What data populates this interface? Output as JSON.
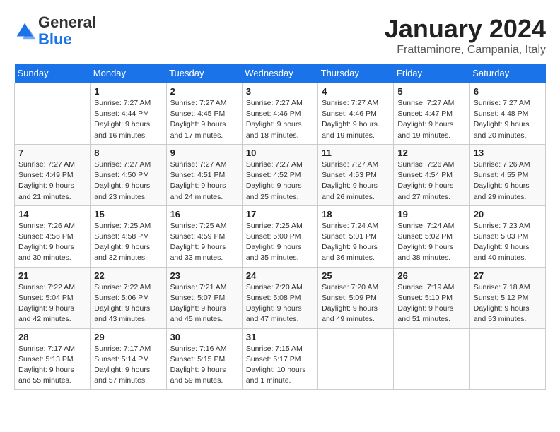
{
  "header": {
    "logo_general": "General",
    "logo_blue": "Blue",
    "month": "January 2024",
    "location": "Frattaminore, Campania, Italy"
  },
  "days_of_week": [
    "Sunday",
    "Monday",
    "Tuesday",
    "Wednesday",
    "Thursday",
    "Friday",
    "Saturday"
  ],
  "weeks": [
    [
      {
        "day": "",
        "info": ""
      },
      {
        "day": "1",
        "info": "Sunrise: 7:27 AM\nSunset: 4:44 PM\nDaylight: 9 hours\nand 16 minutes."
      },
      {
        "day": "2",
        "info": "Sunrise: 7:27 AM\nSunset: 4:45 PM\nDaylight: 9 hours\nand 17 minutes."
      },
      {
        "day": "3",
        "info": "Sunrise: 7:27 AM\nSunset: 4:46 PM\nDaylight: 9 hours\nand 18 minutes."
      },
      {
        "day": "4",
        "info": "Sunrise: 7:27 AM\nSunset: 4:46 PM\nDaylight: 9 hours\nand 19 minutes."
      },
      {
        "day": "5",
        "info": "Sunrise: 7:27 AM\nSunset: 4:47 PM\nDaylight: 9 hours\nand 19 minutes."
      },
      {
        "day": "6",
        "info": "Sunrise: 7:27 AM\nSunset: 4:48 PM\nDaylight: 9 hours\nand 20 minutes."
      }
    ],
    [
      {
        "day": "7",
        "info": "Sunrise: 7:27 AM\nSunset: 4:49 PM\nDaylight: 9 hours\nand 21 minutes."
      },
      {
        "day": "8",
        "info": "Sunrise: 7:27 AM\nSunset: 4:50 PM\nDaylight: 9 hours\nand 23 minutes."
      },
      {
        "day": "9",
        "info": "Sunrise: 7:27 AM\nSunset: 4:51 PM\nDaylight: 9 hours\nand 24 minutes."
      },
      {
        "day": "10",
        "info": "Sunrise: 7:27 AM\nSunset: 4:52 PM\nDaylight: 9 hours\nand 25 minutes."
      },
      {
        "day": "11",
        "info": "Sunrise: 7:27 AM\nSunset: 4:53 PM\nDaylight: 9 hours\nand 26 minutes."
      },
      {
        "day": "12",
        "info": "Sunrise: 7:26 AM\nSunset: 4:54 PM\nDaylight: 9 hours\nand 27 minutes."
      },
      {
        "day": "13",
        "info": "Sunrise: 7:26 AM\nSunset: 4:55 PM\nDaylight: 9 hours\nand 29 minutes."
      }
    ],
    [
      {
        "day": "14",
        "info": "Sunrise: 7:26 AM\nSunset: 4:56 PM\nDaylight: 9 hours\nand 30 minutes."
      },
      {
        "day": "15",
        "info": "Sunrise: 7:25 AM\nSunset: 4:58 PM\nDaylight: 9 hours\nand 32 minutes."
      },
      {
        "day": "16",
        "info": "Sunrise: 7:25 AM\nSunset: 4:59 PM\nDaylight: 9 hours\nand 33 minutes."
      },
      {
        "day": "17",
        "info": "Sunrise: 7:25 AM\nSunset: 5:00 PM\nDaylight: 9 hours\nand 35 minutes."
      },
      {
        "day": "18",
        "info": "Sunrise: 7:24 AM\nSunset: 5:01 PM\nDaylight: 9 hours\nand 36 minutes."
      },
      {
        "day": "19",
        "info": "Sunrise: 7:24 AM\nSunset: 5:02 PM\nDaylight: 9 hours\nand 38 minutes."
      },
      {
        "day": "20",
        "info": "Sunrise: 7:23 AM\nSunset: 5:03 PM\nDaylight: 9 hours\nand 40 minutes."
      }
    ],
    [
      {
        "day": "21",
        "info": "Sunrise: 7:22 AM\nSunset: 5:04 PM\nDaylight: 9 hours\nand 42 minutes."
      },
      {
        "day": "22",
        "info": "Sunrise: 7:22 AM\nSunset: 5:06 PM\nDaylight: 9 hours\nand 43 minutes."
      },
      {
        "day": "23",
        "info": "Sunrise: 7:21 AM\nSunset: 5:07 PM\nDaylight: 9 hours\nand 45 minutes."
      },
      {
        "day": "24",
        "info": "Sunrise: 7:20 AM\nSunset: 5:08 PM\nDaylight: 9 hours\nand 47 minutes."
      },
      {
        "day": "25",
        "info": "Sunrise: 7:20 AM\nSunset: 5:09 PM\nDaylight: 9 hours\nand 49 minutes."
      },
      {
        "day": "26",
        "info": "Sunrise: 7:19 AM\nSunset: 5:10 PM\nDaylight: 9 hours\nand 51 minutes."
      },
      {
        "day": "27",
        "info": "Sunrise: 7:18 AM\nSunset: 5:12 PM\nDaylight: 9 hours\nand 53 minutes."
      }
    ],
    [
      {
        "day": "28",
        "info": "Sunrise: 7:17 AM\nSunset: 5:13 PM\nDaylight: 9 hours\nand 55 minutes."
      },
      {
        "day": "29",
        "info": "Sunrise: 7:17 AM\nSunset: 5:14 PM\nDaylight: 9 hours\nand 57 minutes."
      },
      {
        "day": "30",
        "info": "Sunrise: 7:16 AM\nSunset: 5:15 PM\nDaylight: 9 hours\nand 59 minutes."
      },
      {
        "day": "31",
        "info": "Sunrise: 7:15 AM\nSunset: 5:17 PM\nDaylight: 10 hours\nand 1 minute."
      },
      {
        "day": "",
        "info": ""
      },
      {
        "day": "",
        "info": ""
      },
      {
        "day": "",
        "info": ""
      }
    ]
  ]
}
